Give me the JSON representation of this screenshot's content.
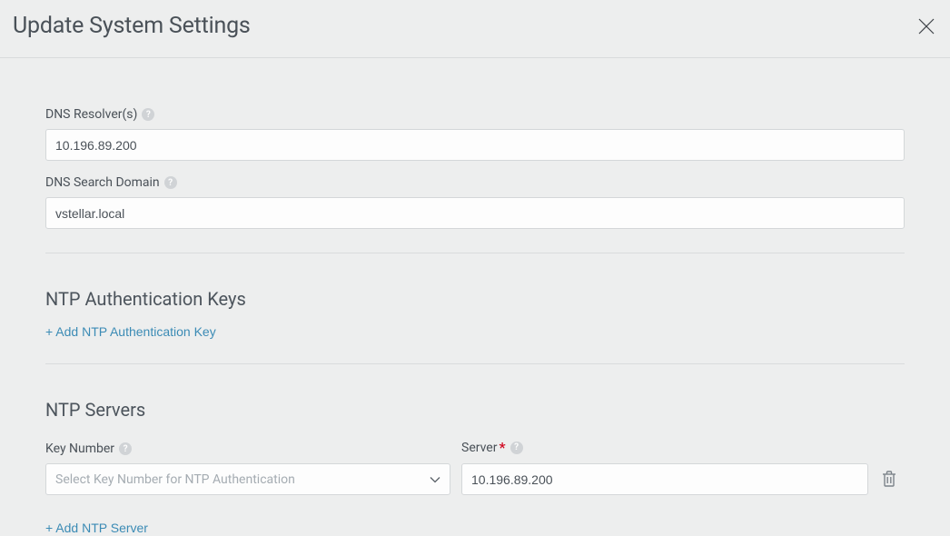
{
  "header": {
    "title": "Update System Settings"
  },
  "dns": {
    "resolvers_label": "DNS Resolver(s)",
    "resolvers_value": "10.196.89.200",
    "search_domain_label": "DNS Search Domain",
    "search_domain_value": "vstellar.local"
  },
  "ntp_auth": {
    "heading": "NTP Authentication Keys",
    "add_link": "+ Add NTP Authentication Key"
  },
  "ntp_servers": {
    "heading": "NTP Servers",
    "key_label": "Key Number",
    "key_placeholder": "Select Key Number for NTP Authentication",
    "server_label": "Server",
    "rows": [
      {
        "server": "10.196.89.200"
      }
    ],
    "add_link": "+ Add NTP Server"
  }
}
